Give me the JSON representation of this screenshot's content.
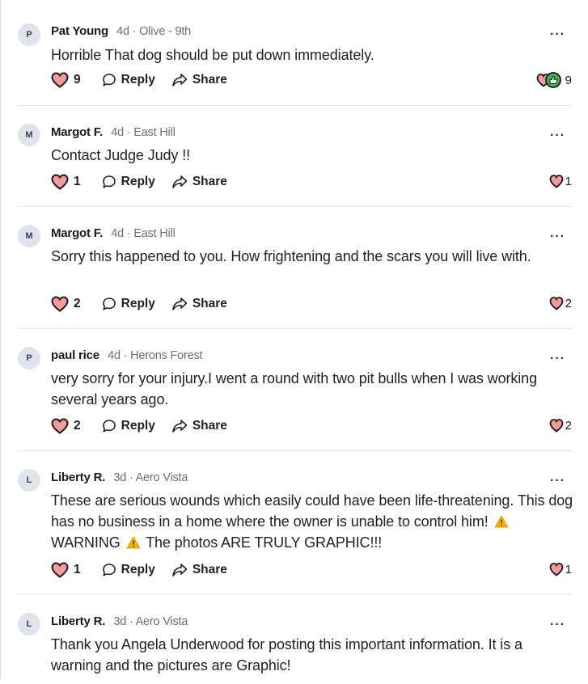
{
  "comments": [
    {
      "initial": "P",
      "author": "Pat Young",
      "meta": "4d · Olive - 9th",
      "text": "Horrible  That dog should be put down immediately.",
      "likes": "9",
      "reply_label": "Reply",
      "share_label": "Share",
      "reaction_count": "9",
      "reaction_types": [
        "heart-icon",
        "thumbs-up-icon"
      ]
    },
    {
      "initial": "M",
      "author": "Margot F.",
      "meta": "4d · East Hill",
      "text": "Contact Judge Judy !!",
      "likes": "1",
      "reply_label": "Reply",
      "share_label": "Share",
      "reaction_count": "1",
      "reaction_types": [
        "heart-icon"
      ]
    },
    {
      "initial": "M",
      "author": "Margot F.",
      "meta": "4d · East Hill",
      "text": "Sorry this happened to you.  How frightening and the scars you will live with.",
      "likes": "2",
      "reply_label": "Reply",
      "share_label": "Share",
      "reaction_count": "2",
      "reaction_types": [
        "heart-icon"
      ]
    },
    {
      "initial": "P",
      "author": "paul rice",
      "meta": "4d · Herons Forest",
      "text": "very sorry for your injury.I went a round with two pit bulls when I was working several years ago.",
      "likes": "2",
      "reply_label": "Reply",
      "share_label": "Share",
      "reaction_count": "2",
      "reaction_types": [
        "heart-icon"
      ]
    },
    {
      "initial": "L",
      "author": "Liberty R.",
      "meta": "3d · Aero Vista",
      "text_part1": "These are serious wounds which easily could have been life-threatening. This dog has no business in a home where the owner is unable to control him!",
      "text_part2": "WARNING",
      "text_part3": "The photos ARE TRULY GRAPHIC!!!",
      "likes": "1",
      "reply_label": "Reply",
      "share_label": "Share",
      "reaction_count": "1",
      "reaction_types": [
        "heart-icon"
      ]
    },
    {
      "initial": "L",
      "author": "Liberty R.",
      "meta": "3d · Aero Vista",
      "text": "Thank you Angela Underwood for posting this important information. It is a warning and the pictures are Graphic!"
    }
  ],
  "colors": {
    "heart_fill": "#f39b9b",
    "heart_stroke": "#1b1b1b",
    "thumb_green": "#37b24d",
    "avatar_bg": "#dfe3ec",
    "divider": "#e6e6e6",
    "meta_gray": "#6b6f78",
    "warning_yellow": "#f5b400"
  }
}
